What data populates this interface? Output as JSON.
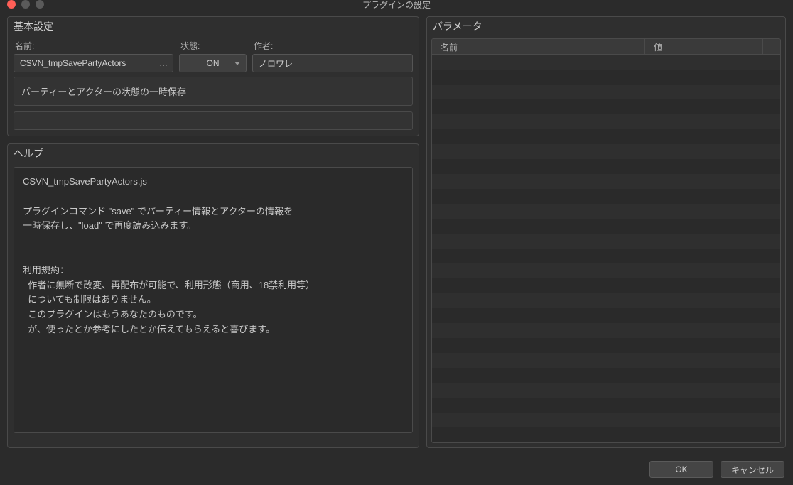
{
  "window": {
    "title": "プラグインの設定"
  },
  "basic": {
    "panel_title": "基本設定",
    "name_label": "名前:",
    "name_value": "CSVN_tmpSavePartyActors",
    "status_label": "状態:",
    "status_value": "ON",
    "author_label": "作者:",
    "author_value": "ノロワレ",
    "description": "パーティーとアクターの状態の一時保存"
  },
  "help": {
    "panel_title": "ヘルプ",
    "text": "CSVN_tmpSavePartyActors.js\n\nプラグインコマンド \"save\" でパーティー情報とアクターの情報を\n一時保存し、\"load\" で再度読み込みます。\n\n\n利用規約：\n  作者に無断で改変、再配布が可能で、利用形態（商用、18禁利用等）\n  についても制限はありません。\n  このプラグインはもうあなたのものです。\n  が、使ったとか参考にしたとか伝えてもらえると喜びます。"
  },
  "params": {
    "panel_title": "パラメータ",
    "col_name": "名前",
    "col_value": "値",
    "rows": []
  },
  "buttons": {
    "ok": "OK",
    "cancel": "キャンセル"
  }
}
